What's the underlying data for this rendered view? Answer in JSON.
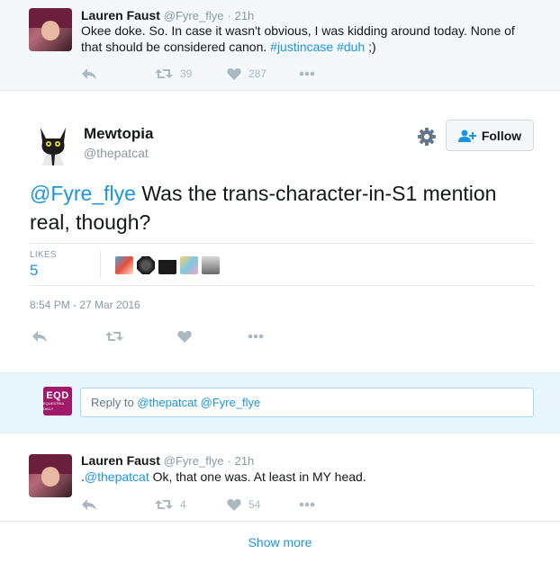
{
  "tweet_top": {
    "fullname": "Lauren Faust",
    "handle": "@Fyre_flye",
    "separator": "·",
    "time": "21h",
    "text_before": "Okee doke. So. In case it wasn't obvious, I was kidding around today. None of that should be considered canon. ",
    "hashtag1": "#justincase",
    "hashtag2": "#duh",
    "text_after": " ;)",
    "retweets": "39",
    "likes": "287"
  },
  "main_tweet": {
    "fullname": "Mewtopia",
    "handle": "@thepatcat",
    "follow_label": "Follow",
    "mention": "@Fyre_flye",
    "text": " Was the trans-character-in-S1 mention real, though?",
    "likes_label": "LIKES",
    "likes_value": "5",
    "timestamp": "8:54 PM - 27 Mar 2016"
  },
  "reply_box": {
    "prefix": "Reply to ",
    "mention1": "@thepatcat",
    "mention2": "@Fyre_flye",
    "logo_text": "EQD",
    "logo_subtext": "EQUESTRIA DAILY"
  },
  "tweet_bottom": {
    "fullname": "Lauren Faust",
    "handle": "@Fyre_flye",
    "separator": "·",
    "time": "21h",
    "text_prefix": ".",
    "mention": "@thepatcat",
    "text": " Ok, that one was. At least in MY head.",
    "retweets": "4",
    "likes": "54"
  },
  "show_more": "Show more",
  "icons": [
    "reply-icon",
    "retweet-icon",
    "heart-icon",
    "more-icon",
    "gear-icon",
    "follow-person-icon"
  ],
  "colors": {
    "link": "#1b95e0",
    "muted": "#8899a6",
    "icon": "#aab8c2",
    "reply_bg": "#e8f5fd"
  }
}
